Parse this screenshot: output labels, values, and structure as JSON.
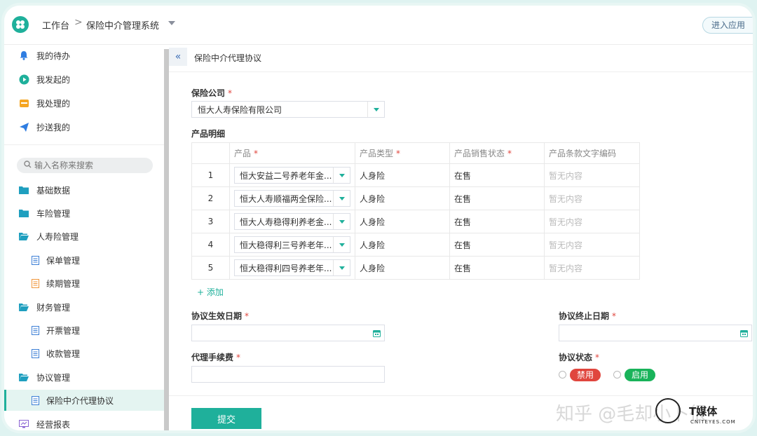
{
  "header": {
    "workbench": "工作台",
    "separator": ">",
    "system": "保险中介管理系统",
    "enter_app": "进入应用"
  },
  "sidebar": {
    "tasks": [
      {
        "label": "我的待办",
        "icon": "bell-icon"
      },
      {
        "label": "我发起的",
        "icon": "play-circle-icon"
      },
      {
        "label": "我处理的",
        "icon": "inbox-icon"
      },
      {
        "label": "抄送我的",
        "icon": "send-icon"
      }
    ],
    "search_placeholder": "输入名称来搜索",
    "menu": {
      "basic_data": "基础数据",
      "car_insurance": "车险管理",
      "life_insurance": "人寿险管理",
      "policy": "保单管理",
      "renewal": "续期管理",
      "finance": "财务管理",
      "invoice": "开票管理",
      "receipt": "收款管理",
      "agreement": "协议管理",
      "agency_agreement": "保险中介代理协议",
      "report": "经营报表"
    }
  },
  "main": {
    "page_title": "保险中介代理协议",
    "company_label": "保险公司",
    "required": "*",
    "company_value": "恒大人寿保险有限公司",
    "product_detail_label": "产品明细",
    "table": {
      "headers": [
        "产品",
        "产品类型",
        "产品销售状态",
        "产品条款文字编码"
      ],
      "rows": [
        {
          "idx": "1",
          "product": "恒大安益二号养老年金...",
          "type": "人身险",
          "status": "在售",
          "code": "暂无内容"
        },
        {
          "idx": "2",
          "product": "恒大人寿顺福两全保险...",
          "type": "人身险",
          "status": "在售",
          "code": "暂无内容"
        },
        {
          "idx": "3",
          "product": "恒大人寿稳得利养老金...",
          "type": "人身险",
          "status": "在售",
          "code": "暂无内容"
        },
        {
          "idx": "4",
          "product": "恒大稳得利三号养老年...",
          "type": "人身险",
          "status": "在售",
          "code": "暂无内容"
        },
        {
          "idx": "5",
          "product": "恒大稳得利四号养老年...",
          "type": "人身险",
          "status": "在售",
          "code": "暂无内容"
        }
      ]
    },
    "add_label": "+ 添加",
    "start_date_label": "协议生效日期",
    "end_date_label": "协议终止日期",
    "fee_label": "代理手续费",
    "status_label": "协议状态",
    "status_disabled": "禁用",
    "status_enabled": "启用",
    "submit": "提交"
  },
  "watermark": {
    "zhihu": "知乎 @毛却小卜很",
    "brand": "T媒体",
    "brand_sub": "CNITEYES.COM"
  },
  "colors": {
    "accent": "#1fb09b",
    "danger": "#e0463e",
    "enabled": "#19b35a",
    "link": "#3d6fb6"
  }
}
